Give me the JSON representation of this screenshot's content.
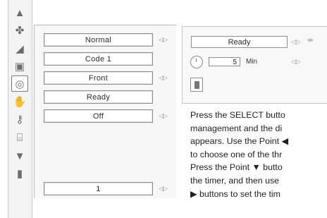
{
  "nav_icons": [
    {
      "name": "input-icon",
      "glyph": "▲"
    },
    {
      "name": "fan-icon",
      "glyph": "✤"
    },
    {
      "name": "image-adjust-icon",
      "glyph": "◢"
    },
    {
      "name": "screen-icon",
      "glyph": "▣"
    },
    {
      "name": "lamp-bulb-icon",
      "glyph": "◎"
    },
    {
      "name": "hand-settings-icon",
      "glyph": "✋"
    },
    {
      "name": "key-icon",
      "glyph": "⚷"
    },
    {
      "name": "network-icon",
      "glyph": "⌸"
    },
    {
      "name": "filter-arrow-icon",
      "glyph": "▼"
    },
    {
      "name": "exit-door-icon",
      "glyph": "▮"
    }
  ],
  "menu_rows": [
    {
      "value": "Normal",
      "has_arrows": true
    },
    {
      "value": "Code 1",
      "has_arrows": false
    },
    {
      "value": "Front",
      "has_arrows": true
    },
    {
      "value": "Ready",
      "has_arrows": false
    },
    {
      "value": "Off",
      "has_arrows": true
    },
    {
      "value": "1",
      "has_arrows": true
    }
  ],
  "sub_panel": {
    "status": "Ready",
    "timer_value": "5",
    "timer_unit": "Min"
  },
  "instructions": [
    "Press the SELECT butto",
    "management and the di",
    "appears. Use the Point ◀",
    "to choose one of the thr",
    "Press the Point ▼ butto",
    "the timer, and then use",
    "▶ buttons to set the tim"
  ]
}
